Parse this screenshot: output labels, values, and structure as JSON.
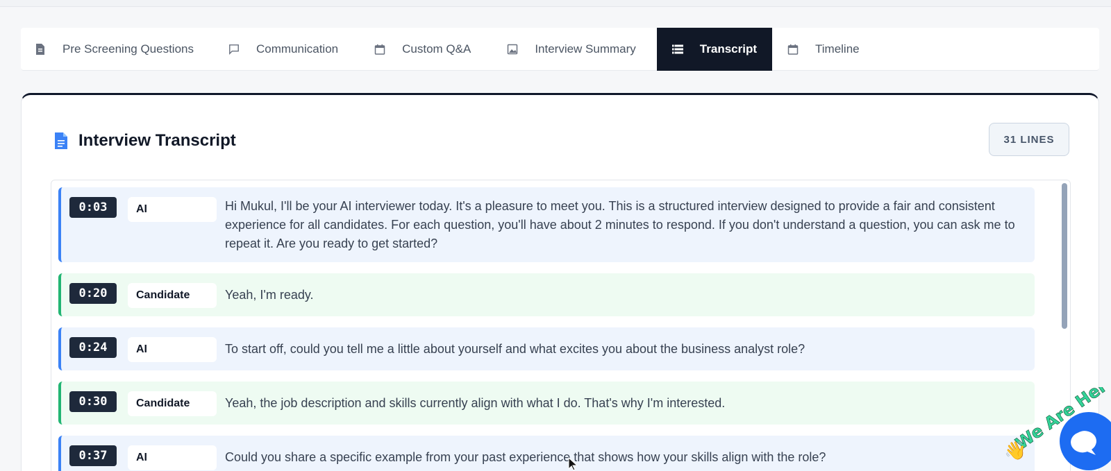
{
  "tabs": [
    {
      "label": "Pre Screening Questions",
      "icon": "document-icon",
      "active": false
    },
    {
      "label": "Communication",
      "icon": "chat-bubble-icon",
      "active": false
    },
    {
      "label": "Custom Q&A",
      "icon": "calendar-icon",
      "active": false
    },
    {
      "label": "Interview Summary",
      "icon": "image-icon",
      "active": false
    },
    {
      "label": "Transcript",
      "icon": "list-icon",
      "active": true
    },
    {
      "label": "Timeline",
      "icon": "calendar-icon",
      "active": false
    }
  ],
  "transcript": {
    "title": "Interview Transcript",
    "lines_badge": "31 LINES",
    "entries": [
      {
        "time": "0:03",
        "speaker": "AI",
        "text": "Hi Mukul, I'll be your AI interviewer today. It's a pleasure to meet you. This is a structured interview designed to provide a fair and consistent experience for all candidates. For each question, you'll have about 2 minutes to respond. If you don't understand a question, you can ask me to repeat it. Are you ready to get started?"
      },
      {
        "time": "0:20",
        "speaker": "Candidate",
        "text": "Yeah, I'm ready."
      },
      {
        "time": "0:24",
        "speaker": "AI",
        "text": "To start off, could you tell me a little about yourself and what excites you about the business analyst role?"
      },
      {
        "time": "0:30",
        "speaker": "Candidate",
        "text": "Yeah, the job description and skills currently align with what I do. That's why I'm interested."
      },
      {
        "time": "0:37",
        "speaker": "AI",
        "text": "Could you share a specific example from your past experience that shows how your skills align with the role?"
      }
    ]
  },
  "chat_widget": {
    "label": "We Are Here",
    "icon": "chat-icon"
  },
  "colors": {
    "ai_accent": "#3b82f6",
    "candidate_accent": "#22b573",
    "active_tab": "#111827"
  }
}
